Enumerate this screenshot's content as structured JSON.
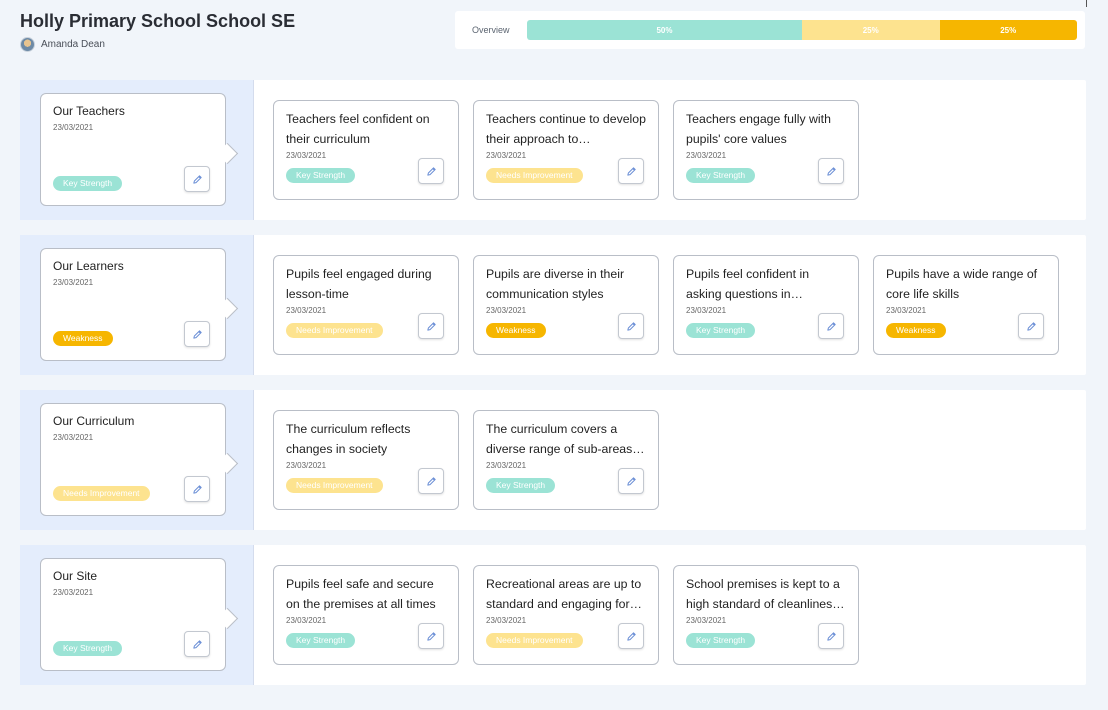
{
  "header": {
    "title": "Holly Primary School School SE",
    "user_name": "Amanda Dean"
  },
  "overview": {
    "label": "Overview",
    "segments": [
      {
        "label": "50%",
        "value": 50,
        "color": "#9be3d5"
      },
      {
        "label": "25%",
        "value": 25,
        "color": "#fde38f"
      },
      {
        "label": "25%",
        "value": 25,
        "color": "#f6b600"
      }
    ]
  },
  "status_colors": {
    "Key Strength": "#9be3d5",
    "Needs Improvement": "#fde38f",
    "Weakness": "#f6b600"
  },
  "sections": [
    {
      "title": "Our Teachers",
      "date": "23/03/2021",
      "status": "Key Strength",
      "cards": [
        {
          "title": "Teachers feel confident on their curriculum",
          "date": "23/03/2021",
          "status": "Key Strength"
        },
        {
          "title": "Teachers continue to develop their approach to…",
          "date": "23/03/2021",
          "status": "Needs Improvement"
        },
        {
          "title": "Teachers engage fully with pupils' core values",
          "date": "23/03/2021",
          "status": "Key Strength"
        }
      ]
    },
    {
      "title": "Our Learners",
      "date": "23/03/2021",
      "status": "Weakness",
      "cards": [
        {
          "title": "Pupils feel engaged during lesson-time",
          "date": "23/03/2021",
          "status": "Needs Improvement"
        },
        {
          "title": "Pupils are diverse in their communication styles",
          "date": "23/03/2021",
          "status": "Weakness"
        },
        {
          "title": "Pupils feel confident in asking questions in…",
          "date": "23/03/2021",
          "status": "Key Strength"
        },
        {
          "title": "Pupils have a wide range of core life skills",
          "date": "23/03/2021",
          "status": "Weakness"
        }
      ]
    },
    {
      "title": "Our Curriculum",
      "date": "23/03/2021",
      "status": "Needs Improvement",
      "cards": [
        {
          "title": "The curriculum reflects changes in society",
          "date": "23/03/2021",
          "status": "Needs Improvement"
        },
        {
          "title": "The curriculum covers a diverse range of sub-areas…",
          "date": "23/03/2021",
          "status": "Key Strength"
        }
      ]
    },
    {
      "title": "Our Site",
      "date": "23/03/2021",
      "status": "Key Strength",
      "cards": [
        {
          "title": "Pupils feel safe and secure on the premises at all times",
          "date": "23/03/2021",
          "status": "Key Strength"
        },
        {
          "title": "Recreational areas are up to standard and engaging for…",
          "date": "23/03/2021",
          "status": "Needs Improvement"
        },
        {
          "title": "School premises is kept to a high standard of cleanlines…",
          "date": "23/03/2021",
          "status": "Key Strength"
        }
      ]
    }
  ]
}
